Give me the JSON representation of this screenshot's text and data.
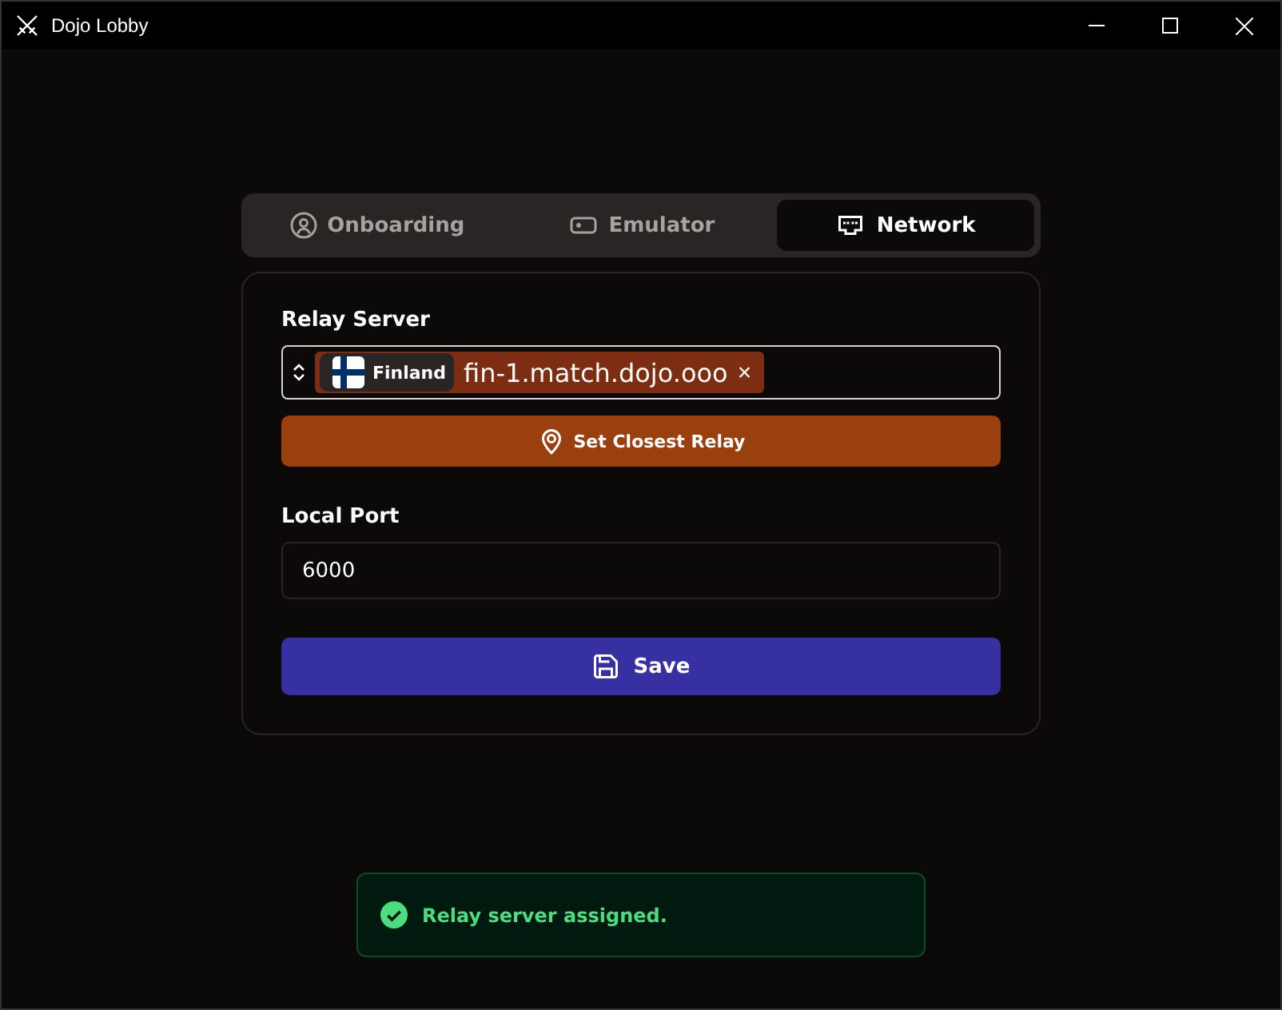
{
  "window": {
    "title": "Dojo Lobby"
  },
  "tabs": [
    {
      "label": "Onboarding",
      "selected": false
    },
    {
      "label": "Emulator",
      "selected": false
    },
    {
      "label": "Network",
      "selected": true
    }
  ],
  "relay_server": {
    "label": "Relay Server",
    "country": "Finland",
    "value": "fin-1.match.dojo.ooo",
    "remove": "×"
  },
  "closest_button": "Set Closest Relay",
  "local_port": {
    "label": "Local Port",
    "value": "6000"
  },
  "save_button": "Save",
  "toast": {
    "message": "Relay server assigned."
  }
}
